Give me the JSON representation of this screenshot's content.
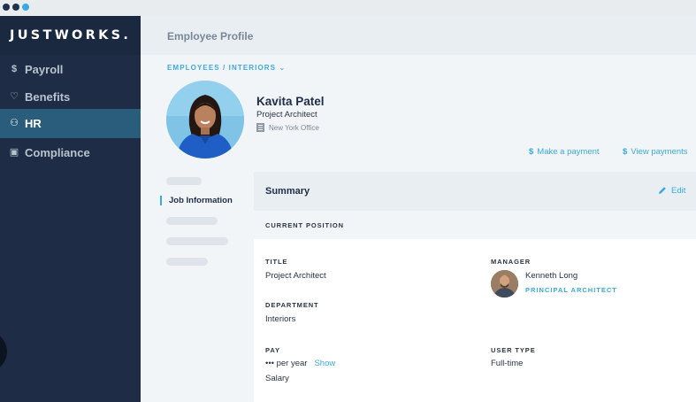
{
  "window": {
    "controls": [
      "close",
      "minimize",
      "maximize"
    ]
  },
  "sidebar": {
    "brand": "JUSTWORKS.",
    "items": [
      {
        "icon": "dollar-icon",
        "glyph": "$",
        "label": "Payroll",
        "active": false
      },
      {
        "icon": "heart-icon",
        "glyph": "♡",
        "label": "Benefits",
        "active": false
      },
      {
        "icon": "people-icon",
        "glyph": "⚇",
        "label": "HR",
        "active": true
      },
      {
        "icon": "clipboard-icon",
        "glyph": "▣",
        "label": "Compliance",
        "active": false
      }
    ]
  },
  "header": {
    "title": "Employee Profile"
  },
  "profile": {
    "breadcrumb": "EMPLOYEES / INTERIORS",
    "breadcrumb_chevron": "⌄",
    "name": "Kavita Patel",
    "title": "Project Architect",
    "office": "New York Office",
    "actions": {
      "make_payment": "Make a payment",
      "view_payments": "View payments",
      "dollar_glyph": "$"
    }
  },
  "subnav": {
    "active_label": "Job Information"
  },
  "summary": {
    "heading": "Summary",
    "edit_label": "Edit",
    "section": "CURRENT POSITION",
    "fields": {
      "title_label": "TITLE",
      "title_value": "Project Architect",
      "manager_label": "MANAGER",
      "manager_name": "Kenneth Long",
      "manager_role": "PRINCIPAL ARCHITECT",
      "department_label": "DEPARTMENT",
      "department_value": "Interiors",
      "pay_label": "PAY",
      "pay_value": "••• per year",
      "pay_show": "Show",
      "pay_type": "Salary",
      "user_type_label": "USER TYPE",
      "user_type_value": "Full-time"
    }
  },
  "colors": {
    "sidebar_bg": "#1e2d45",
    "active_nav": "#2a5d7c",
    "accent": "#39a9e0",
    "text_dark": "#1e2d45"
  }
}
